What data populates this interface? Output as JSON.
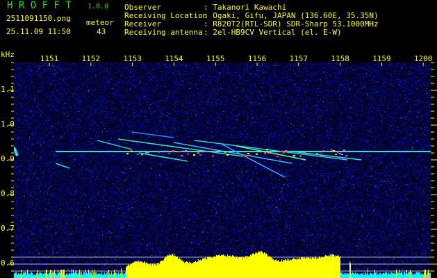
{
  "header": {
    "app_title": "H R O F F T",
    "version": "1.0.0",
    "filename": "2511091150.png",
    "datetime": "25.11.09 11:50",
    "meteor_label": "meteor",
    "meteor_count": "43"
  },
  "info": [
    {
      "label": "Observer",
      "value": ": Takanori Kawachi"
    },
    {
      "label": "Receiving Location",
      "value": ": Ogaki, Gifu, JAPAN (136.60E, 35.35N)"
    },
    {
      "label": "Receiver",
      "value": ": R820T2(RTL-SDR) SDR-Sharp 53.1000MHz"
    },
    {
      "label": "Receiving antenna",
      "value": ": 2el-HB9CV Vertical (el. E-W)"
    }
  ],
  "axes": {
    "x_ticks": [
      "1151",
      "1152",
      "1153",
      "1154",
      "1155",
      "1156",
      "1157",
      "1158",
      "1159",
      "1200"
    ],
    "y_unit": "kHz",
    "y_ticks": [
      "1.1",
      "1.0",
      "0.9",
      "0.8",
      "0.7",
      "0.6"
    ]
  },
  "colors": {
    "text": "#ffff00",
    "title": "#22dd22",
    "noise": "#1010a0",
    "carrier": "#30e0e0",
    "bars": "#ffff00",
    "bars_low": "#00ffff"
  }
}
